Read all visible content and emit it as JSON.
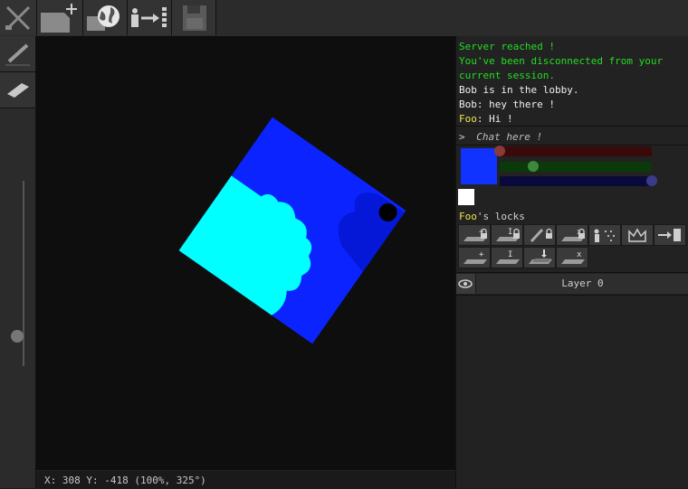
{
  "toolbar": {
    "buttons": [
      {
        "name": "disconnect-button",
        "icon": "crossed-tools-icon"
      },
      {
        "name": "new-canvas-button",
        "icon": "new-canvas-plus-icon"
      },
      {
        "name": "host-online-button",
        "icon": "globe-icon"
      },
      {
        "name": "join-session-button",
        "icon": "person-arrow-icon"
      },
      {
        "name": "save-button",
        "icon": "floppy-disk-icon"
      }
    ]
  },
  "tools": [
    {
      "name": "pencil-tool",
      "icon": "pencil-icon"
    },
    {
      "name": "eraser-tool",
      "icon": "eraser-icon"
    }
  ],
  "brush_size_level": 0.16,
  "chat": {
    "lines": [
      {
        "parts": [
          {
            "text": "Server reached !",
            "color": "green"
          }
        ]
      },
      {
        "parts": [
          {
            "text": "You've been disconnected from your",
            "color": "green"
          }
        ]
      },
      {
        "parts": [
          {
            "text": "current session.",
            "color": "green"
          }
        ]
      },
      {
        "parts": [
          {
            "text": "Bob",
            "color": "white"
          },
          {
            "text": " is in the lobby.",
            "color": "white"
          }
        ]
      },
      {
        "parts": [
          {
            "text": "Bob",
            "color": "white"
          },
          {
            "text": ": hey there !",
            "color": "white"
          }
        ]
      },
      {
        "parts": [
          {
            "text": "Foo",
            "color": "yellow"
          },
          {
            "text": ": Hi !",
            "color": "white"
          }
        ]
      }
    ],
    "prompt": ">",
    "placeholder": "Chat here !"
  },
  "color": {
    "swatch": "#1133ff",
    "red": {
      "value": "0",
      "fraction": 0.0
    },
    "green": {
      "value": "56",
      "fraction": 0.22
    },
    "blue": {
      "value": "255",
      "fraction": 1.0
    }
  },
  "secondary_color": "#ffffff",
  "locks": {
    "owner": "Foo",
    "suffix": "'s locks",
    "buttons": [
      {
        "name": "lock-add-layer-button",
        "icon": "layer-plus-lock-icon"
      },
      {
        "name": "lock-rename-layer-button",
        "icon": "layer-text-lock-icon"
      },
      {
        "name": "lock-draw-button",
        "icon": "pencil-lock-icon"
      },
      {
        "name": "lock-delete-layer-button",
        "icon": "layer-x-lock-icon"
      },
      {
        "name": "lock-chat-button",
        "icon": "megaphone-icon"
      },
      {
        "name": "lock-admin-button",
        "icon": "crown-icon"
      },
      {
        "name": "kick-user-button",
        "icon": "exit-door-icon"
      },
      {
        "name": "add-layer-button",
        "icon": "layer-plus-icon"
      },
      {
        "name": "rename-layer-button",
        "icon": "layer-text-icon"
      },
      {
        "name": "merge-layer-button",
        "icon": "layer-merge-icon"
      },
      {
        "name": "delete-layer-button",
        "icon": "layer-x-icon"
      }
    ]
  },
  "layers": [
    {
      "name": "Layer 0",
      "visible": true
    }
  ],
  "status": {
    "text": "X: 308 Y: -418 (100%, 325°)"
  },
  "palette": {
    "cyan": "#00ffff",
    "blue": "#0b23ff",
    "dark_blue": "#0625d8"
  }
}
